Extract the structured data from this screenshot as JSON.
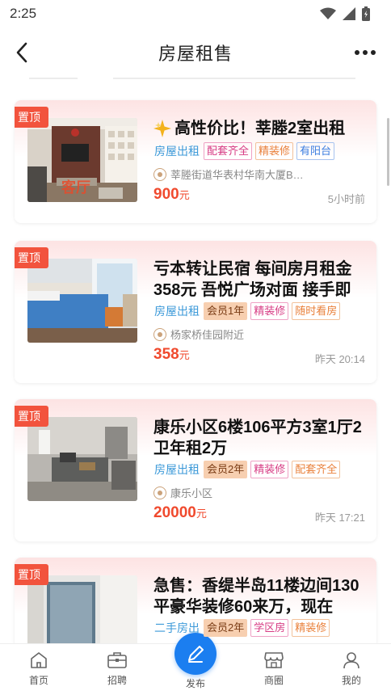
{
  "status": {
    "time": "2:25"
  },
  "nav": {
    "title": "房屋租售"
  },
  "pin_label": "置顶",
  "listings": [
    {
      "title": "高性价比！莘塍2室出租",
      "has_sparkle": true,
      "type": "房屋出租",
      "tags": [
        "配套齐全",
        "精装修",
        "有阳台"
      ],
      "address": "莘塍街道华表村华南大厦B…",
      "price": "900",
      "price_unit": "元",
      "time": "5小时前",
      "thumb_caption": "客厅"
    },
    {
      "title": "亏本转让民宿 每间房月租金358元 吾悦广场对面 接手即",
      "type": "房屋出租",
      "tags": [
        "会员1年",
        "精装修",
        "随时看房"
      ],
      "address": "杨家桥佳园附近",
      "price": "358",
      "price_unit": "元",
      "time": "昨天 20:14"
    },
    {
      "title": "康乐小区6楼106平方3室1厅2卫年租2万",
      "type": "房屋出租",
      "tags": [
        "会员2年",
        "精装修",
        "配套齐全"
      ],
      "address": "康乐小区",
      "price": "20000",
      "price_unit": "元",
      "time": "昨天 17:21"
    },
    {
      "title": "急售：香缇半岛11楼边间130平豪华装修60来万，现在",
      "type": "二手房出",
      "tags": [
        "会员2年",
        "学区房",
        "精装修"
      ]
    }
  ],
  "tabbar": {
    "home": "首页",
    "jobs": "招聘",
    "post": "发布",
    "shops": "商圈",
    "mine": "我的"
  },
  "colors": {
    "accent_blue": "#1b7ef0",
    "pin_red": "#f2533d",
    "price_red": "#f04a2e"
  }
}
